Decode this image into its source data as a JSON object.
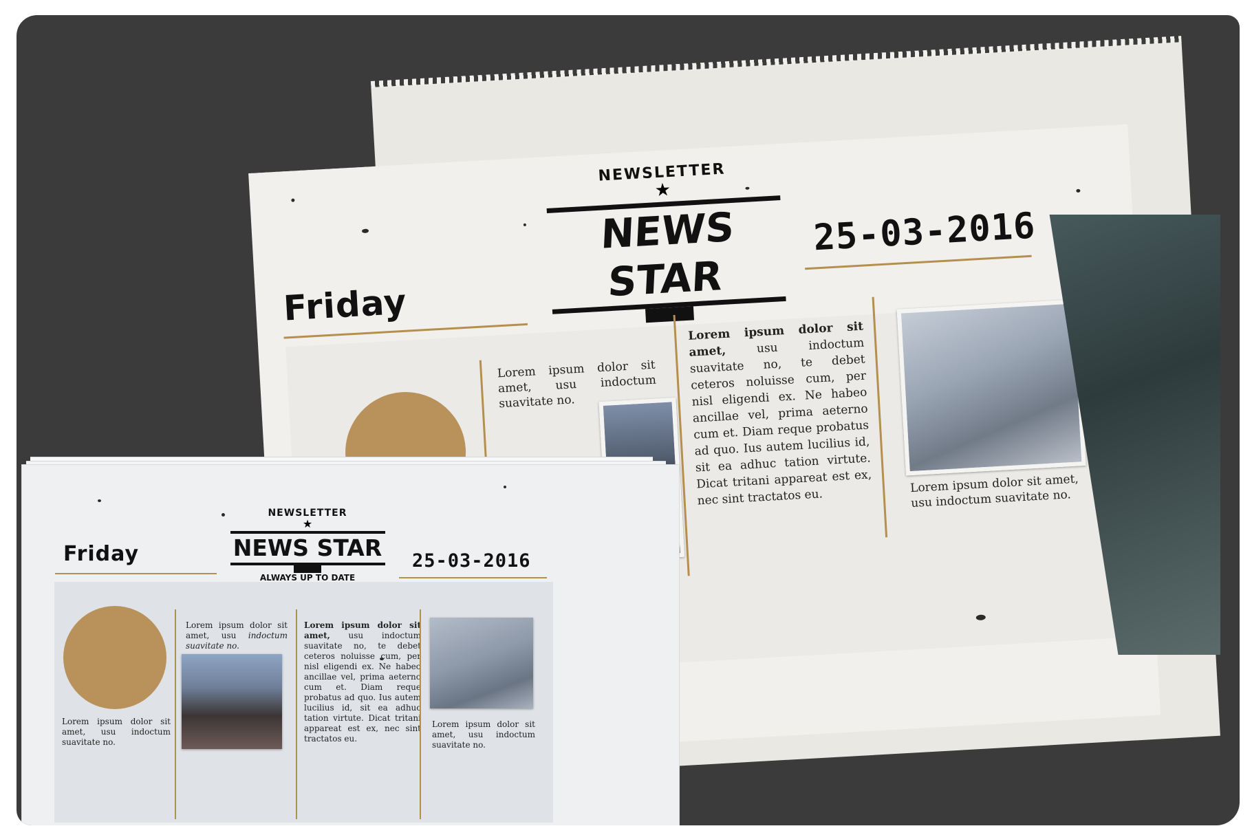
{
  "newsletter": {
    "arc_top": "NEWSLETTER",
    "star": "★",
    "title": "NEWS STAR",
    "arc_bottom": "ALWAYS UP TO DATE",
    "day": "Friday",
    "date": "25-03-2016"
  },
  "articles": {
    "col1_text": "Lorem ipsum dolor sit amet, usu indoctum suavitate no.",
    "col2_lead": "Lorem ipsum dolor sit amet,",
    "col2_text": " usu indoctum suavitate no, te debet ceteros noluisse cum, per nisl eligendi ex. Ne habeo ancillae vel, prima aeterno cum et. Diam reque probatus ad quo. Ius autem lucilius id, sit ea adhuc tation virtute. Dicat tritani appareat est ex, nec sint tractatos eu.",
    "col3_text": "Lorem ipsum dolor sit amet, usu indoctum suavitate no.",
    "col3_plain": "Lorem ipsum dolor sit amet, usu",
    "col3_italic": "indoctum suavitate no."
  },
  "colors": {
    "board": "#3b3b3b",
    "paper": "#f1f0ec",
    "paper_small": "#eef0f2",
    "accent_gold": "#b58f4e",
    "ink": "#111111"
  }
}
